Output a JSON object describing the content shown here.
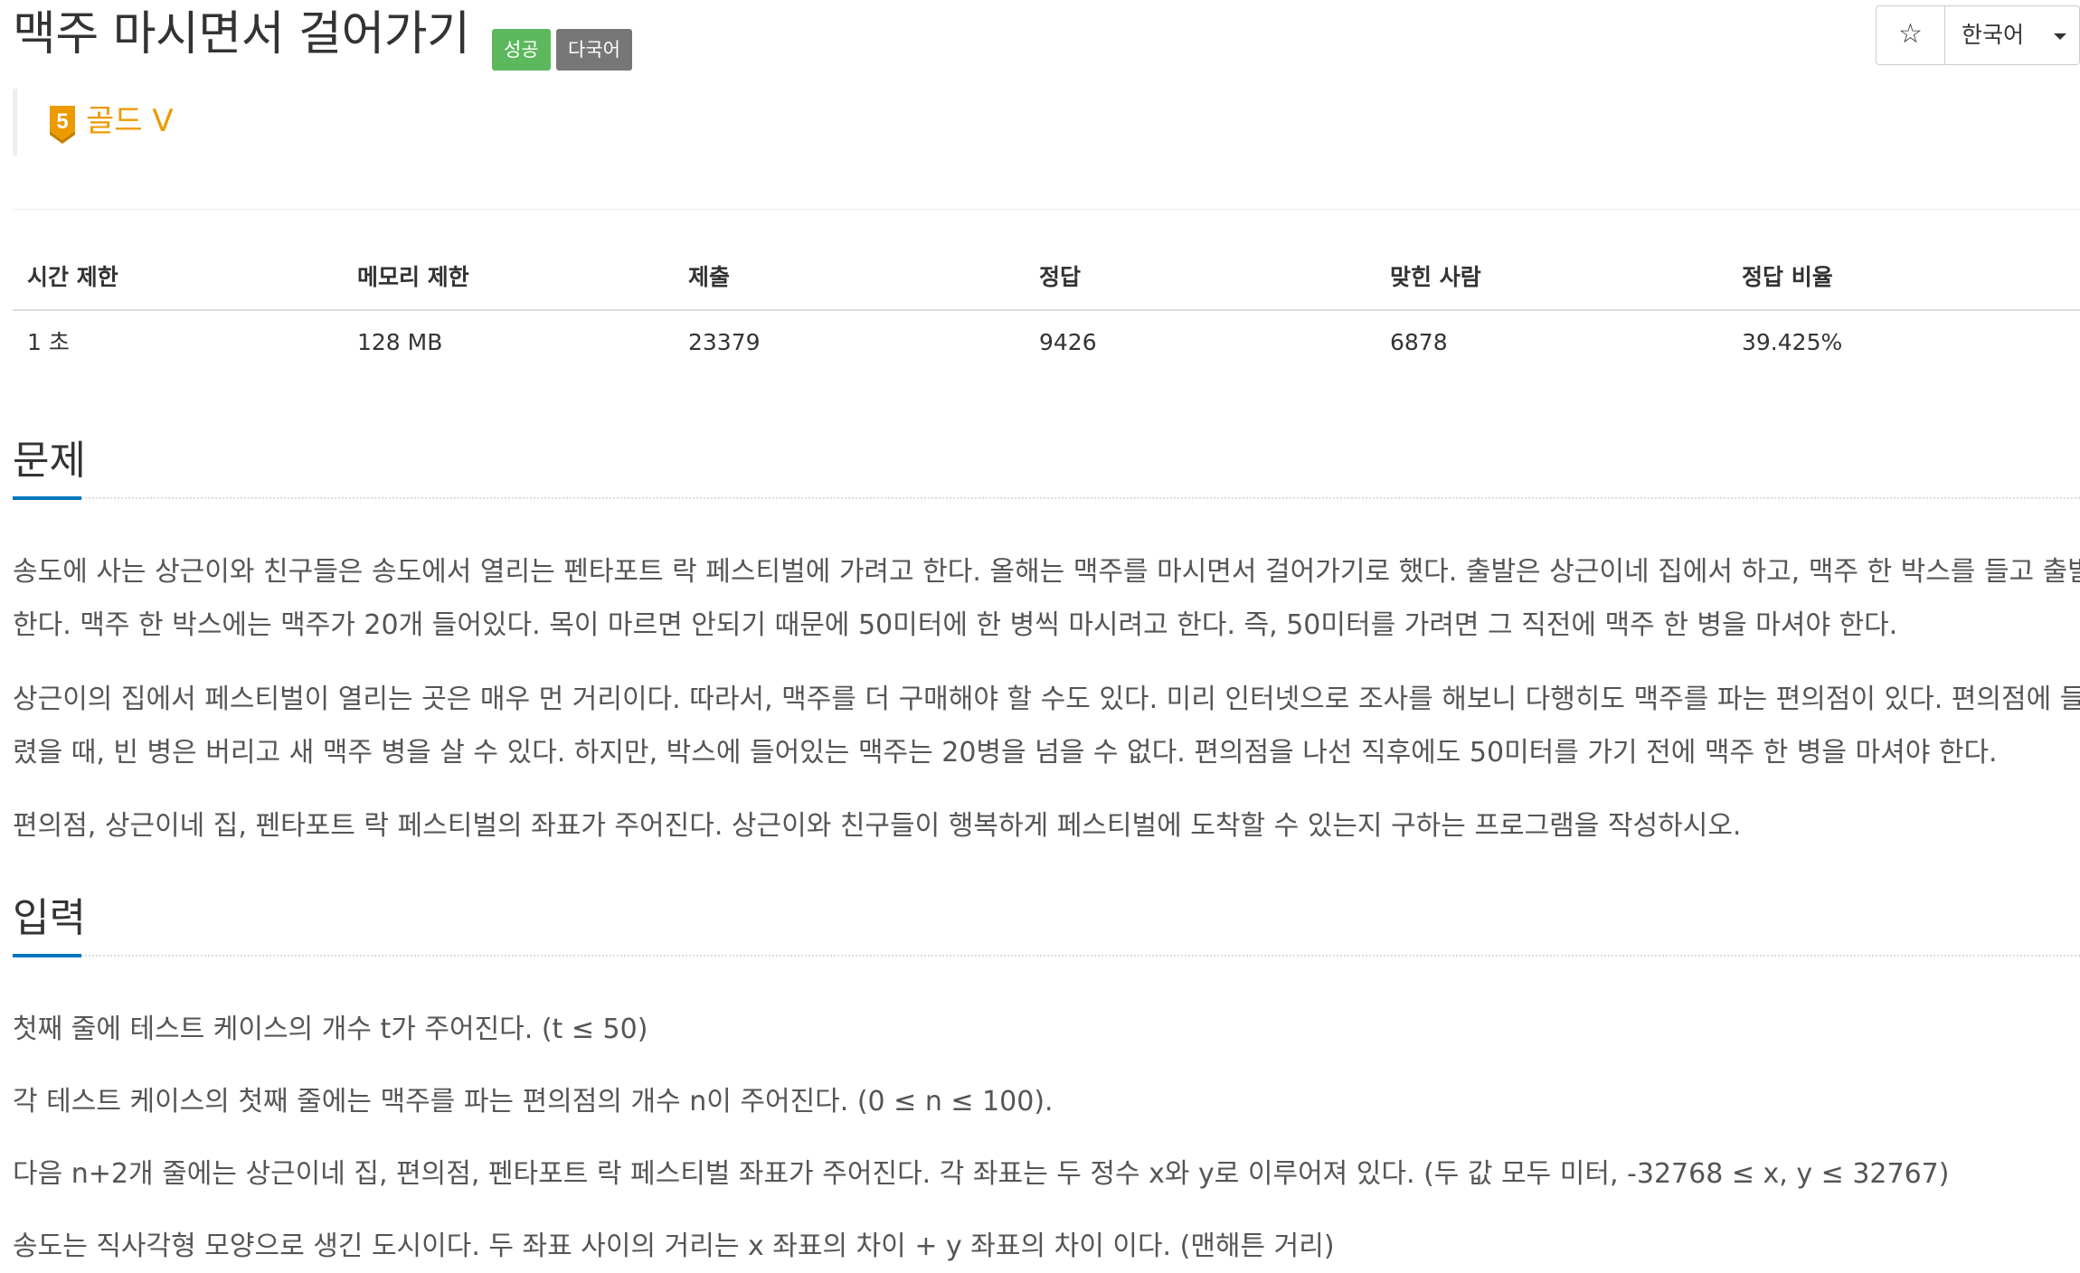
{
  "title": "맥주 마시면서 걸어가기",
  "badges": {
    "success": "성공",
    "multilang": "다국어"
  },
  "tools": {
    "star_glyph": "☆",
    "language": "한국어"
  },
  "tier": {
    "level": "5",
    "label": "골드 V",
    "color": "#ec9a00"
  },
  "stats": {
    "headers": [
      "시간 제한",
      "메모리 제한",
      "제출",
      "정답",
      "맞힌 사람",
      "정답 비율"
    ],
    "values": [
      "1 초",
      "128 MB",
      "23379",
      "9426",
      "6878",
      "39.425%"
    ]
  },
  "problem": {
    "title": "문제",
    "lines": [
      "송도에 사는 상근이와 친구들은 송도에서 열리는 펜타포트 락 페스티벌에 가려고 한다. 올해는 맥주를 마시면서 걸어가기로 했다. 출발은 상근이네 집에서 하고, 맥주 한 박스를 들고 출발",
      "한다. 맥주 한 박스에는 맥주가 20개 들어있다. 목이 마르면 안되기 때문에 50미터에 한 병씩 마시려고 한다. 즉, 50미터를 가려면 그 직전에 맥주 한 병을 마셔야 한다.",
      "상근이의 집에서 페스티벌이 열리는 곳은 매우 먼 거리이다. 따라서, 맥주를 더 구매해야 할 수도 있다. 미리 인터넷으로 조사를 해보니 다행히도 맥주를 파는 편의점이 있다. 편의점에 들",
      "렸을 때, 빈 병은 버리고 새 맥주 병을 살 수 있다. 하지만, 박스에 들어있는 맥주는 20병을 넘을 수 없다. 편의점을 나선 직후에도 50미터를 가기 전에 맥주 한 병을 마셔야 한다.",
      "편의점, 상근이네 집, 펜타포트 락 페스티벌의 좌표가 주어진다. 상근이와 친구들이 행복하게 페스티벌에 도착할 수 있는지 구하는 프로그램을 작성하시오."
    ]
  },
  "input": {
    "title": "입력",
    "lines": [
      "첫째 줄에 테스트 케이스의 개수 t가 주어진다. (t ≤ 50)",
      "각 테스트 케이스의 첫째 줄에는 맥주를 파는 편의점의 개수 n이 주어진다. (0 ≤ n ≤ 100).",
      "다음 n+2개 줄에는 상근이네 집, 편의점, 펜타포트 락 페스티벌 좌표가 주어진다. 각 좌표는 두 정수 x와 y로 이루어져 있다. (두 값 모두 미터, -32768 ≤ x, y ≤ 32767)",
      "송도는 직사각형 모양으로 생긴 도시이다. 두 좌표 사이의 거리는 x 좌표의 차이 + y 좌표의 차이 이다. (맨해튼 거리)"
    ]
  },
  "colors": {
    "success_badge": "#5cb85c",
    "multilang_badge": "#777777",
    "section_accent": "#0076c0",
    "tier_gold": "#ec9a00"
  }
}
